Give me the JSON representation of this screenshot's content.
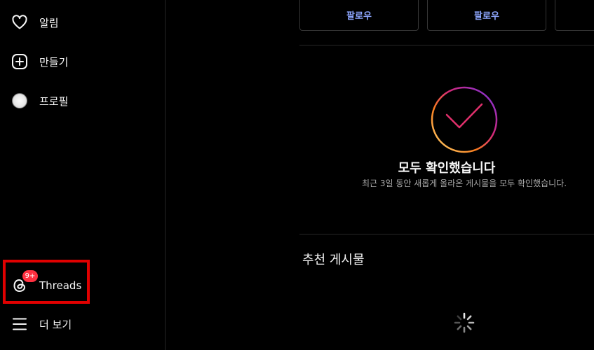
{
  "sidebar": {
    "items": [
      {
        "label": "알림",
        "icon": "heart-icon"
      },
      {
        "label": "만들기",
        "icon": "plus-square-icon"
      },
      {
        "label": "프로필",
        "icon": "avatar"
      },
      {
        "label": "Threads",
        "icon": "threads-icon",
        "badge": "9+"
      },
      {
        "label": "더 보기",
        "icon": "menu-icon"
      }
    ]
  },
  "suggestions": {
    "follow_buttons": [
      "팔로우",
      "팔로우"
    ]
  },
  "caught_up": {
    "title": "모두 확인했습니다",
    "subtitle": "최근 3일 동안 새롭게 올라온 게시물을 모두 확인했습니다."
  },
  "recommended": {
    "title": "추천 게시물"
  },
  "colors": {
    "background": "#000000",
    "link": "#8ea7ff",
    "badge": "#ff3040",
    "highlight": "#e00000"
  }
}
